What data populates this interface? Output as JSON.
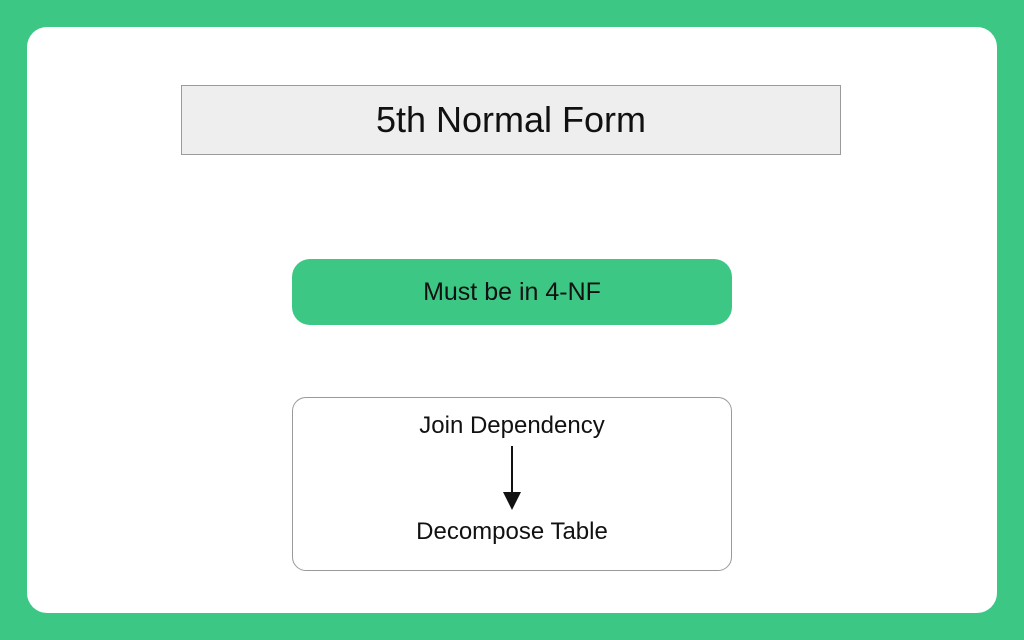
{
  "title": "5th Normal Form",
  "precondition": "Must be in 4-NF",
  "flow": {
    "from": "Join Dependency",
    "to": "Decompose Table"
  },
  "colors": {
    "accent": "#3dc785",
    "titleBg": "#eeeeee",
    "border": "#9a9a9a",
    "text": "#111111"
  }
}
